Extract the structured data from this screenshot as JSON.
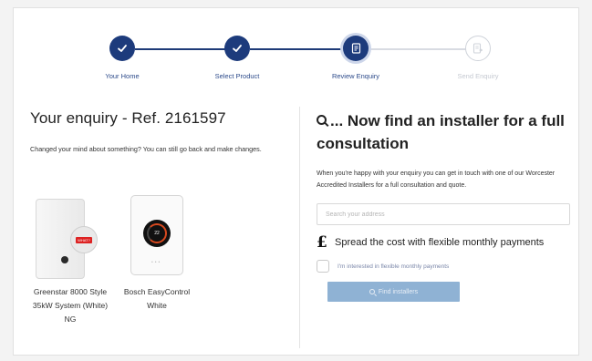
{
  "stepper": {
    "steps": [
      {
        "label": "Your Home",
        "state": "done",
        "icon": "check-icon"
      },
      {
        "label": "Select Product",
        "state": "done",
        "icon": "check-icon"
      },
      {
        "label": "Review Enquiry",
        "state": "active",
        "icon": "document-icon"
      },
      {
        "label": "Send Enquiry",
        "state": "future",
        "icon": "send-document-icon"
      }
    ]
  },
  "enquiry": {
    "title": "Your enquiry - Ref. 2161597",
    "description": "Changed your mind about something? You can still go back and make changes."
  },
  "products": [
    {
      "name": "Greenstar 8000 Style 35kW System (White) NG",
      "badge": "WHAT?"
    },
    {
      "name": "Bosch EasyControl White",
      "screen": "22"
    }
  ],
  "installer": {
    "title": "... Now find an installer for a full consultation",
    "description": "When you're happy with your enquiry you can get in touch with one of our Worcester Accredited Installers for a full consultation and quote.",
    "address_placeholder": "Search your address",
    "finance_text": "Spread the cost with flexible monthly payments",
    "finance_checkbox_label": "I'm interested in flexible monthly payments",
    "find_button_label": "Find installers"
  },
  "colors": {
    "primary": "#1d3b7c",
    "button_disabled": "#8fb2d4",
    "step_future": "#cfd3da"
  }
}
